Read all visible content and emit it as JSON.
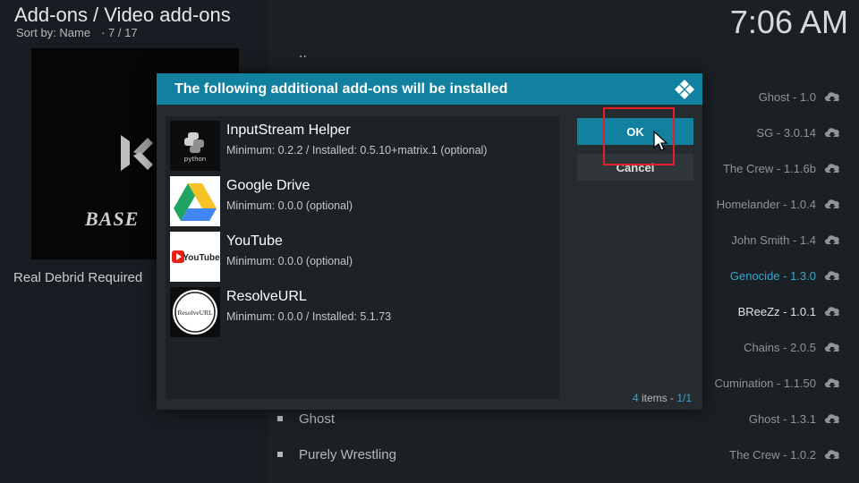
{
  "header": {
    "title": "Add-ons / Video add-ons",
    "sort": "Sort by: Name",
    "position": "7 / 17",
    "clock": "7:06 AM"
  },
  "left": {
    "thumb_text": "BASE",
    "description": "Real Debrid Required"
  },
  "list": {
    "parent": "..",
    "right_items": [
      {
        "label": "Ghost - 1.0",
        "style": "normal"
      },
      {
        "label": "SG - 3.0.14",
        "style": "normal"
      },
      {
        "label": "The Crew - 1.1.6b",
        "style": "normal"
      },
      {
        "label": "Homelander - 1.0.4",
        "style": "normal"
      },
      {
        "label": "John Smith - 1.4",
        "style": "normal"
      },
      {
        "label": "Genocide - 1.3.0",
        "style": "highlight"
      },
      {
        "label": "BReeZz - 1.0.1",
        "style": "white"
      },
      {
        "label": "Chains - 2.0.5",
        "style": "normal"
      },
      {
        "label": "Cumination - 1.1.50",
        "style": "normal"
      },
      {
        "label": "Ghost - 1.3.1",
        "style": "normal"
      },
      {
        "label": "The Crew - 1.0.2",
        "style": "normal"
      }
    ],
    "bottom_items": [
      "Ghost",
      "Purely Wrestling"
    ]
  },
  "dialog": {
    "title": "The following additional add-ons will be installed",
    "items": [
      {
        "name": "InputStream Helper",
        "meta": "Minimum: 0.2.2 / Installed: 0.5.10+matrix.1 (optional)",
        "icon": "python-icon",
        "icon_text": "python"
      },
      {
        "name": "Google Drive",
        "meta": "Minimum: 0.0.0 (optional)",
        "icon": "google-drive-icon",
        "icon_text": ""
      },
      {
        "name": "YouTube",
        "meta": "Minimum: 0.0.0 (optional)",
        "icon": "youtube-icon",
        "icon_text": "YouTube"
      },
      {
        "name": "ResolveURL",
        "meta": "Minimum: 0.0.0 / Installed: 5.1.73",
        "icon": "resolveurl-icon",
        "icon_text": "ResolveURL"
      }
    ],
    "ok_label": "OK",
    "cancel_label": "Cancel",
    "count_num": "4",
    "count_label": "items -",
    "page": "1/1"
  },
  "colors": {
    "accent": "#12809f",
    "highlight_text": "#34a7d0",
    "annotation": "#e2202a"
  }
}
